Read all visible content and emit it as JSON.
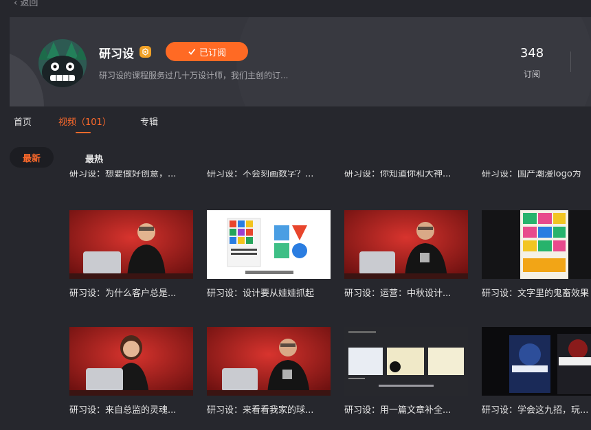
{
  "nav": {
    "back_label": "返回"
  },
  "channel": {
    "name": "研习设",
    "subscribe_label": "已订阅",
    "description": "研习设的课程服务过几十万设计师，我们主创的订...",
    "stats": {
      "count": "348",
      "label": "订阅"
    }
  },
  "tabs": [
    {
      "label": "首页",
      "active": false
    },
    {
      "label": "视频（101）",
      "active": true
    },
    {
      "label": "专辑",
      "active": false
    }
  ],
  "sort": {
    "latest": "最新",
    "hot": "最热"
  },
  "partial_row_titles": [
    "研习设：想要做好创意，...",
    "研习设：不会刻画数字？...",
    "研习设：你知道你和大神...",
    "研习设：国产潮漫logo为"
  ],
  "videos": [
    {
      "title": "研习设：为什么客户总是...",
      "thumb": "presenter-red"
    },
    {
      "title": "研习设：设计要从娃娃抓起",
      "thumb": "poster-white"
    },
    {
      "title": "研习设：运营：中秋设计...",
      "thumb": "presenter-red"
    },
    {
      "title": "研习设：文字里的鬼畜效果",
      "thumb": "poster-colorful"
    },
    {
      "title": "研习设：来自总监的灵魂...",
      "thumb": "presenter-red-female"
    },
    {
      "title": "研习设：来看看我家的球...",
      "thumb": "presenter-red"
    },
    {
      "title": "研习设：用一篇文章补全...",
      "thumb": "slide-dark"
    },
    {
      "title": "研习设：学会这九招，玩...",
      "thumb": "sports-posters"
    }
  ],
  "colors": {
    "accent": "#ff6a24",
    "background": "#26272d",
    "header": "#35363d",
    "badge": "#f0a127"
  }
}
